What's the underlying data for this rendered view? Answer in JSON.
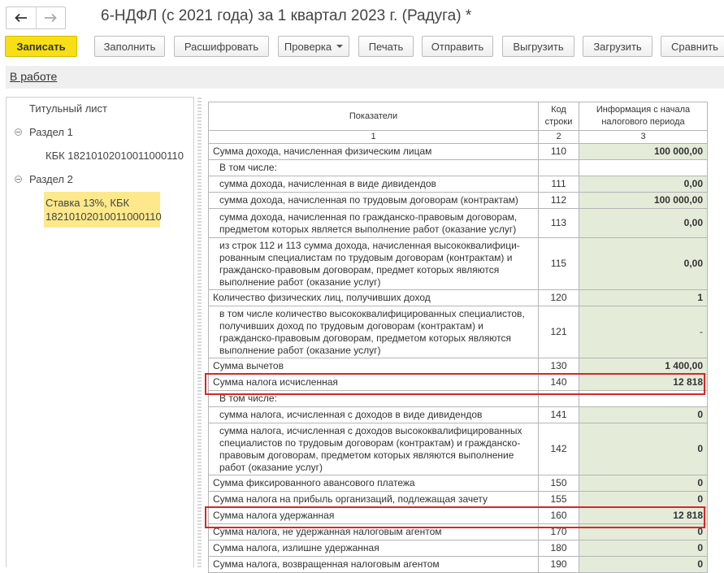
{
  "window": {
    "title": "6-НДФЛ (с 2021 года) за 1 квартал 2023 г. (Радуга) *"
  },
  "toolbar": {
    "save": "Записать",
    "fill": "Заполнить",
    "decode": "Расшифровать",
    "check": "Проверка",
    "print": "Печать",
    "send": "Отправить",
    "export": "Выгрузить",
    "import": "Загрузить",
    "compare": "Сравнить"
  },
  "status": {
    "label": "В работе"
  },
  "sidebar": {
    "items": [
      {
        "label": "Титульный лист"
      },
      {
        "label": "Раздел 1"
      },
      {
        "label": "КБК 18210102010011000110"
      },
      {
        "label": "Раздел 2"
      }
    ],
    "selected": {
      "line1": "Ставка 13%, КБК",
      "line2": "18210102010011000110"
    }
  },
  "table": {
    "headers": {
      "indicators": "Показатели",
      "code_l1": "Код",
      "code_l2": "строки",
      "info_l1": "Информация с начала",
      "info_l2": "налогового периода"
    },
    "numbers": [
      "1",
      "2",
      "3"
    ],
    "rows": [
      {
        "label": "Сумма дохода, начисленная физическим лицам",
        "code": "110",
        "value": "100 000,00"
      },
      {
        "label": "В том числе:",
        "code": "",
        "value": ""
      },
      {
        "label": "сумма дохода, начисленная в виде дивидендов",
        "code": "111",
        "value": "0,00"
      },
      {
        "label": "сумма дохода, начисленная по трудовым договорам (контрактам)",
        "code": "112",
        "value": "100 000,00"
      },
      {
        "label": "сумма дохода, начисленная по гражданско-правовым договорам, предметом которых является выполнение работ (оказание услуг)",
        "code": "113",
        "value": "0,00"
      },
      {
        "label": "из строк 112 и 113 сумма дохода, начисленная высококвалифици-рованным специалистам по трудовым договорам (контрактам) и гражданско-правовым договорам, предмет которых являются выполнение работ (оказание услуг)",
        "code": "115",
        "value": "0,00"
      },
      {
        "label": "Количество физических лиц, получивших доход",
        "code": "120",
        "value": "1"
      },
      {
        "label": "в том числе количество высококвалифицированных специалистов, получивших доход по трудовым договорам (контрактам) и гражданско-правовым договорам, предметом которых являются выполнение работ (оказание услуг)",
        "code": "121",
        "value": "-"
      },
      {
        "label": "Сумма вычетов",
        "code": "130",
        "value": "1 400,00"
      },
      {
        "label": "Сумма налога исчисленная",
        "code": "140",
        "value": "12 818"
      },
      {
        "label": "В том числе:",
        "code": "",
        "value": ""
      },
      {
        "label": "сумма налога, исчисленная с доходов в виде дивидендов",
        "code": "141",
        "value": "0"
      },
      {
        "label": "сумма налога, исчисленная с доходов высококвалифицированных специалистов по трудовым договорам (контрактам) и гражданско-правовым договорам, предметом которых являются выполнение работ (оказание услуг)",
        "code": "142",
        "value": "0"
      },
      {
        "label": "Сумма фиксированного авансового платежа",
        "code": "150",
        "value": "0"
      },
      {
        "label": "Сумма налога на прибыль организаций, подлежащая зачету",
        "code": "155",
        "value": "0"
      },
      {
        "label": "Сумма налога удержанная",
        "code": "160",
        "value": "12 818"
      },
      {
        "label": "Сумма налога, не удержанная налоговым агентом",
        "code": "170",
        "value": "0"
      },
      {
        "label": "Сумма налога, излишне удержанная",
        "code": "180",
        "value": "0"
      },
      {
        "label": "Сумма налога, возвращенная налоговым агентом",
        "code": "190",
        "value": "0"
      }
    ]
  },
  "colors": {
    "primary": "#f8df14",
    "highlight": "#d7262b",
    "cell_fill": "#e4ecd9",
    "selected": "#fde98b"
  }
}
